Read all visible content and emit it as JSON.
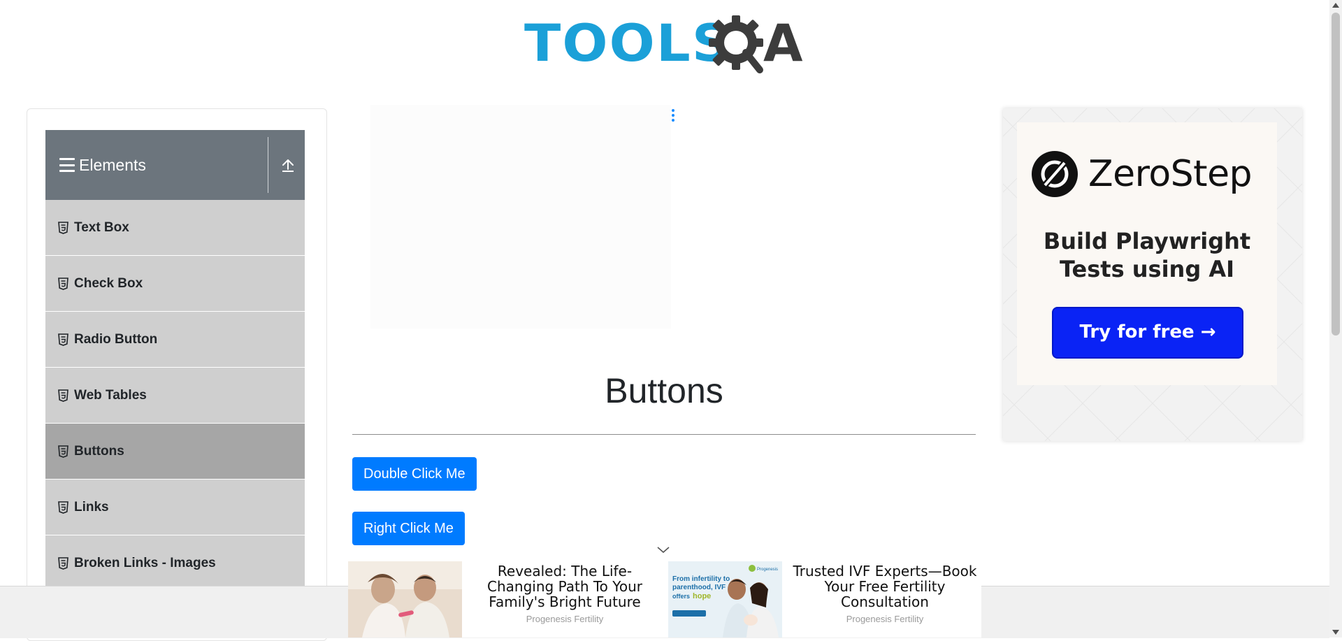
{
  "header": {
    "logo": {
      "text_left": "TOOLS",
      "text_right": "A",
      "left_color": "#1ba0d8",
      "right_color": "#3c3c3c"
    }
  },
  "sidebar": {
    "group_title": "Elements",
    "group_icon": "hamburger-icon",
    "collapse_icon": "upload-icon",
    "items": [
      {
        "label": "Text Box",
        "icon": "html5-icon",
        "active": false
      },
      {
        "label": "Check Box",
        "icon": "html5-icon",
        "active": false
      },
      {
        "label": "Radio Button",
        "icon": "html5-icon",
        "active": false
      },
      {
        "label": "Web Tables",
        "icon": "html5-icon",
        "active": false
      },
      {
        "label": "Buttons",
        "icon": "html5-icon",
        "active": true
      },
      {
        "label": "Links",
        "icon": "html5-icon",
        "active": false
      },
      {
        "label": "Broken Links - Images",
        "icon": "html5-icon",
        "active": false
      }
    ]
  },
  "main": {
    "title": "Buttons",
    "buttons": {
      "double_click": "Double Click Me",
      "right_click": "Right Click Me"
    },
    "button_color": "#007bff"
  },
  "side_ad": {
    "brand": "ZeroStep",
    "tagline": "Build Playwright Tests using AI",
    "cta": "Try for free →",
    "cta_color": "#0a23f5"
  },
  "bottom_ads": [
    {
      "headline": "Revealed: The Life-Changing Path To Your Family's Bright Future",
      "source": "Progenesis Fertility"
    },
    {
      "headline": "Trusted IVF Experts—Book Your Free Fertility Consultation",
      "source": "Progenesis Fertility",
      "image_text": {
        "line1": "From infertility to",
        "line2": "parenthood, IVF",
        "line3": "offers",
        "highlight": "hope",
        "logo": "Progenesis"
      }
    }
  ]
}
